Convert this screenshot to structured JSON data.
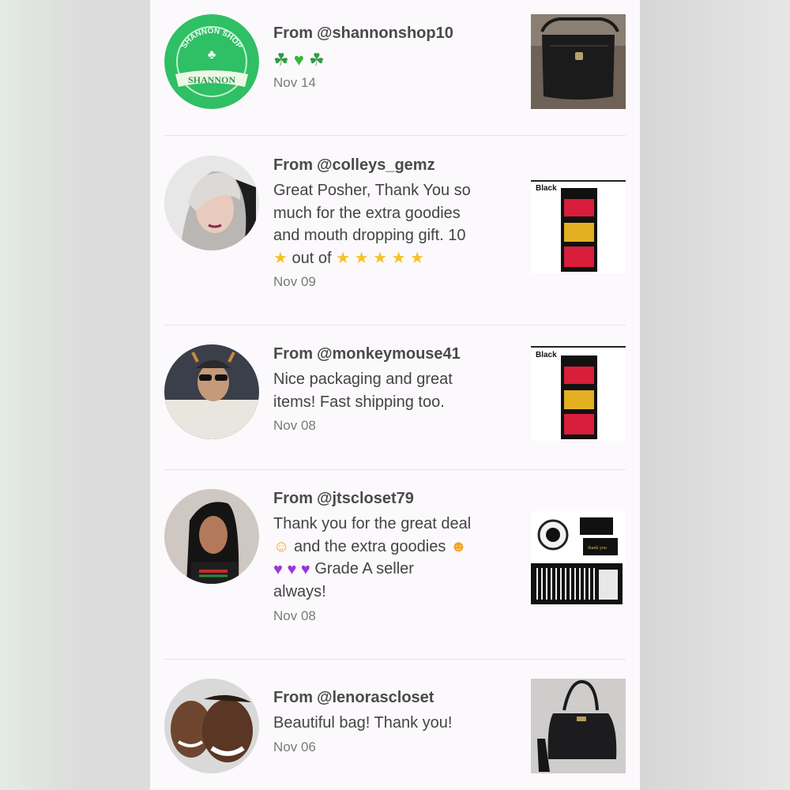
{
  "reviews": [
    {
      "from_prefix": "From",
      "handle": "@shannonshop10",
      "message": "",
      "date": "Nov 14",
      "avatar": {
        "logo_top": "SHANNON SHOP",
        "logo_banner": "SHANNON"
      },
      "thumb_label": ""
    },
    {
      "from_prefix": "From",
      "handle": "@colleys_gemz",
      "message_line1": "Great Posher, Thank You so",
      "message_line2": "much for the extra goodies",
      "message_line3": "and mouth dropping gift. 10",
      "message_line4_mid": "out of",
      "date": "Nov 09",
      "thumb_label": "Black"
    },
    {
      "from_prefix": "From",
      "handle": "@monkeymouse41",
      "message_line1": "Nice packaging and great",
      "message_line2": "items! Fast shipping too.",
      "date": "Nov 08",
      "thumb_label": "Black"
    },
    {
      "from_prefix": "From",
      "handle": "@jtscloset79",
      "message_line1": "Thank you for the great deal",
      "message_line2_a": "and the extra goodies",
      "message_line3_a": "Grade A seller",
      "message_line4": "always!",
      "date": "Nov 08",
      "thumb_text": "thank you"
    },
    {
      "from_prefix": "From",
      "handle": "@lenorascloset",
      "message_line1": "Beautiful bag! Thank you!",
      "date": "Nov 06"
    }
  ]
}
